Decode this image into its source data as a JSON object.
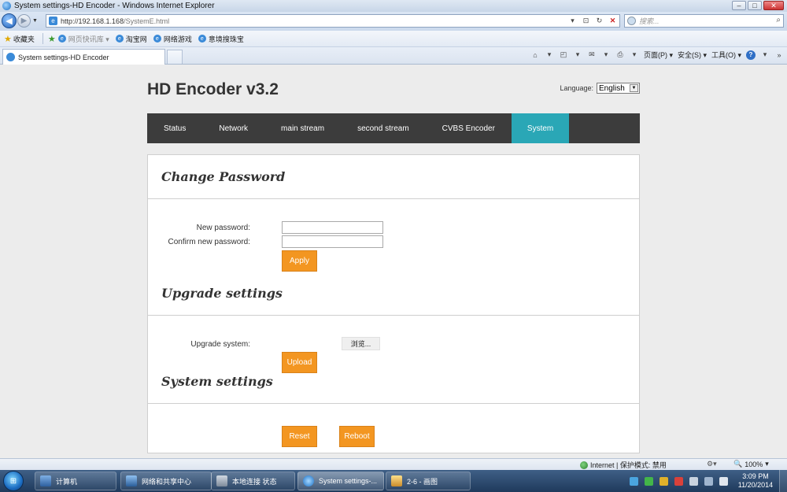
{
  "window": {
    "title": "System settings-HD Encoder - Windows Internet Explorer",
    "buttons": [
      "‒",
      "□",
      "✕"
    ]
  },
  "addressbar": {
    "url_host": "http://192.168.1.168",
    "url_path": "/SystemE.html",
    "search_placeholder": "搜索..."
  },
  "favorites": {
    "label": "收藏夹",
    "items": [
      "网页快讯库 ▾",
      "淘宝网",
      "网络游戏",
      "意境搜珠宝"
    ]
  },
  "tab": {
    "title": "System settings-HD Encoder"
  },
  "commandbar": {
    "page": "页面(P) ▾",
    "safety": "安全(S) ▾",
    "tools": "工具(O) ▾"
  },
  "page": {
    "brand": "HD Encoder v3.2",
    "language_label": "Language:",
    "language_value": "English",
    "nav": [
      "Status",
      "Network",
      "main stream",
      "second stream",
      "CVBS Encoder",
      "System"
    ],
    "active_nav": "System",
    "change_password": {
      "title": "Change Password",
      "new_label": "New password:",
      "confirm_label": "Confirm new password:",
      "apply": "Apply"
    },
    "upgrade": {
      "title": "Upgrade settings",
      "label": "Upgrade system:",
      "browse": "浏览...",
      "upload": "Upload"
    },
    "system": {
      "title": "System settings",
      "reset": "Reset",
      "reboot": "Reboot"
    }
  },
  "statusbar": {
    "zone": "Internet | 保护模式: 禁用",
    "zoom": "100%"
  },
  "taskbar": {
    "items": [
      "计算机",
      "网络和共享中心",
      "本地连接 状态",
      "System settings-...",
      "2-6 - 画图"
    ],
    "time": "3:09 PM",
    "date": "11/20/2014"
  },
  "colors": {
    "nav_bg": "#3c3c3c",
    "nav_active": "#2aa7b6",
    "button": "#f39621",
    "page_bg": "#ececec"
  }
}
